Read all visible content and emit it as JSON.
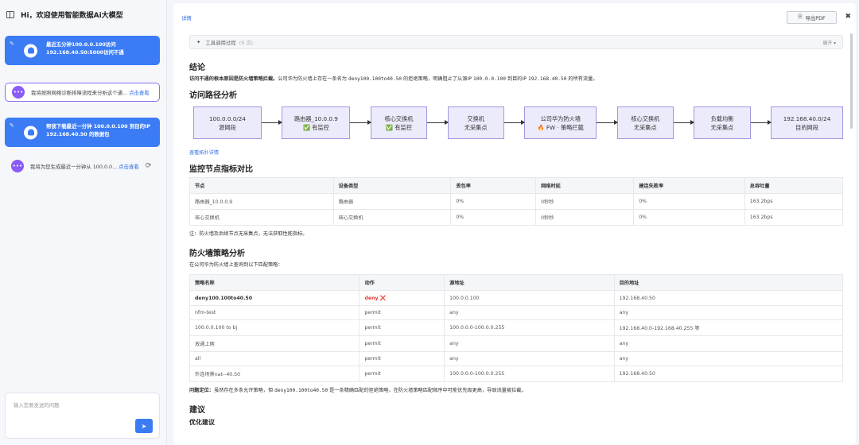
{
  "sidebar": {
    "header_title": "Hi，欢迎使用智能数据Ai大模型",
    "messages": [
      {
        "type": "user",
        "text": "最近五分钟100.0.0.100访问192.168.40.50:5000访问不通"
      },
      {
        "type": "ai",
        "text": "我将按照网络诊断排障流程来分析这个通...",
        "link": "点击查看",
        "selected": true
      },
      {
        "type": "user",
        "text": "帮我下载最近一分钟 100.0.0.100 到目的IP 192.168.40.50 的数据包"
      },
      {
        "type": "ai",
        "text": "我将为您生成最近一分钟从 100.0.0...",
        "link": "点击查看",
        "selected": false
      }
    ],
    "input_placeholder": "输入您要发送的问题"
  },
  "topbar": {
    "tab": "详情",
    "export_label": "导出PDF"
  },
  "tool_panel": {
    "label": "工具调用过程",
    "count": "(9 次)",
    "expand": "展开"
  },
  "conclusion": {
    "heading": "结论",
    "bold": "访问不通的根本原因是防火墙策略拦截。",
    "text1": "公司华为防火墙上存在一条名为 ",
    "policy": "deny100.100to40.50",
    "text2": " 的拒绝策略，明确阻止了从源IP ",
    "src": "100.0.0.100",
    "text3": " 到目的IP ",
    "dst": "192.168.40.50",
    "text4": " 的所有流量。"
  },
  "path": {
    "heading": "访问路径分析",
    "nodes": [
      {
        "l1": "100.0.0.0/24",
        "l2": "源网段"
      },
      {
        "l1": "路由器_10.0.0.9",
        "l2": "✅ 有监控"
      },
      {
        "l1": "核心交换机",
        "l2": "✅ 有监控"
      },
      {
        "l1": "交换机",
        "l2": "无采集点"
      },
      {
        "l1": "公司华为防火墙",
        "l2": "🔥 FW · 策略拦截"
      },
      {
        "l1": "核心交换机",
        "l2": "无采集点"
      },
      {
        "l1": "负载均衡",
        "l2": "无采集点"
      },
      {
        "l1": "192.168.40.0/24",
        "l2": "目的网段"
      }
    ],
    "topo_link": "查看拓扑详情"
  },
  "monitor": {
    "heading": "监控节点指标对比",
    "columns": [
      "节点",
      "设备类型",
      "丢包率",
      "网络时延",
      "建连失败率",
      "总吞吐量"
    ],
    "rows": [
      [
        "路由器_10.0.0.9",
        "路由器",
        "0%",
        "0秒秒",
        "0%",
        "163.2bps"
      ],
      [
        "核心交换机",
        "核心交换机",
        "0%",
        "0秒秒",
        "0%",
        "163.2bps"
      ]
    ],
    "note": "注：防火墙及后续节点无采集点，无法获取性能指标。"
  },
  "firewall": {
    "heading": "防火墙策略分析",
    "intro": "在公司华为防火墙上查询到以下匹配策略：",
    "columns": [
      "策略名称",
      "动作",
      "源地址",
      "目的地址"
    ],
    "rows": [
      [
        "deny100.100to40.50",
        "deny ❌",
        "100.0.0.100",
        "192.168.40.50"
      ],
      [
        "nfm-test",
        "permit",
        "any",
        "any"
      ],
      [
        "100.0.0.100 to bj",
        "permit",
        "100.0.0.0-100.0.0.255",
        "192.168.40.0-192.168.40.255 等"
      ],
      [
        "放通上网",
        "permit",
        "any",
        "any"
      ],
      [
        "all",
        "permit",
        "any",
        "any"
      ],
      [
        "外连场景nat--40.50",
        "permit",
        "100.0.0.0-100.0.0.255",
        "192.168.40.50"
      ]
    ],
    "issue_bold": "问题定位：",
    "issue_text1": "虽然存在多条允许策略，但 ",
    "issue_policy": "deny100.100to40.50",
    "issue_text2": " 是一条精确匹配的拒绝策略，在防火墙策略匹配顺序中可能优先级更高，导致流量被拦截。"
  },
  "suggest": {
    "heading": "建议",
    "sub": "优化建议"
  }
}
